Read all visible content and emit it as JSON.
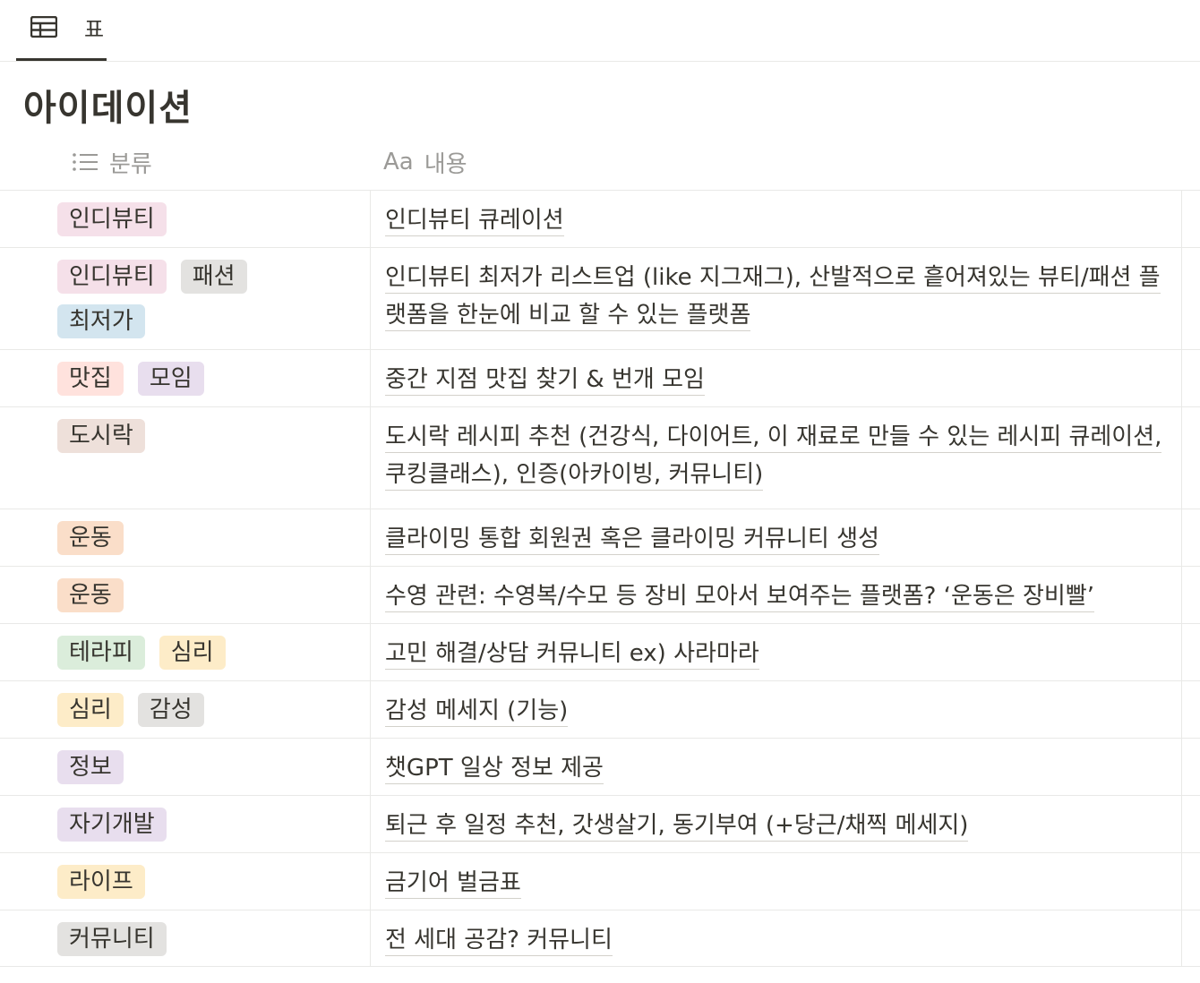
{
  "tab": {
    "label": "표",
    "icon": "table-icon"
  },
  "title": "아이데이션",
  "columns": [
    {
      "label": "분류",
      "icon": "list-icon"
    },
    {
      "label": "내용",
      "icon": "text-aa-icon",
      "icon_text": "Aa"
    }
  ],
  "tag_colors": {
    "pink": "#f5e0e9",
    "gray": "#e3e2e0",
    "blue": "#d3e5ef",
    "red": "#ffe2dd",
    "purple": "#e8deee",
    "brown": "#eee0da",
    "orange": "#fadec9",
    "green": "#dbeddb",
    "yellow": "#fdecc8"
  },
  "rows": [
    {
      "tags": [
        {
          "label": "인디뷰티",
          "color": "pink"
        }
      ],
      "content": "인디뷰티 큐레이션"
    },
    {
      "tags": [
        {
          "label": "인디뷰티",
          "color": "pink"
        },
        {
          "label": "패션",
          "color": "gray"
        },
        {
          "label": "최저가",
          "color": "blue"
        }
      ],
      "content": "인디뷰티 최저가 리스트업 (like 지그재그), 산발적으로 흩어져있는 뷰티/패션 플랫폼을 한눈에 비교 할 수 있는 플랫폼"
    },
    {
      "tags": [
        {
          "label": "맛집",
          "color": "red"
        },
        {
          "label": "모임",
          "color": "purple"
        }
      ],
      "content": "중간 지점 맛집 찾기 & 번개 모임"
    },
    {
      "tags": [
        {
          "label": "도시락",
          "color": "brown"
        }
      ],
      "content": "도시락 레시피 추천 (건강식, 다이어트, 이 재료로 만들 수 있는 레시피 큐레이션, 쿠킹클래스), 인증(아카이빙, 커뮤니티)"
    },
    {
      "tags": [
        {
          "label": "운동",
          "color": "orange"
        }
      ],
      "content": "클라이밍 통합 회원권  혹은 클라이밍 커뮤니티 생성"
    },
    {
      "tags": [
        {
          "label": "운동",
          "color": "orange"
        }
      ],
      "content": "수영 관련: 수영복/수모 등 장비 모아서 보여주는 플랫폼? ‘운동은 장비빨’"
    },
    {
      "tags": [
        {
          "label": "테라피",
          "color": "green"
        },
        {
          "label": "심리",
          "color": "yellow"
        }
      ],
      "content": " 고민 해결/상담 커뮤니티 ex) 사라마라"
    },
    {
      "tags": [
        {
          "label": "심리",
          "color": "yellow"
        },
        {
          "label": "감성",
          "color": "gray"
        }
      ],
      "content": "감성 메세지 (기능)"
    },
    {
      "tags": [
        {
          "label": "정보",
          "color": "purple"
        }
      ],
      "content": "챗GPT 일상 정보 제공"
    },
    {
      "tags": [
        {
          "label": "자기개발",
          "color": "purple"
        }
      ],
      "content": "퇴근 후 일정 추천, 갓생살기, 동기부여 (+당근/채찍 메세지)"
    },
    {
      "tags": [
        {
          "label": "라이프",
          "color": "yellow"
        }
      ],
      "content": "금기어 벌금표"
    },
    {
      "tags": [
        {
          "label": "커뮤니티",
          "color": "gray"
        }
      ],
      "content": "전 세대 공감? 커뮤니티"
    }
  ]
}
